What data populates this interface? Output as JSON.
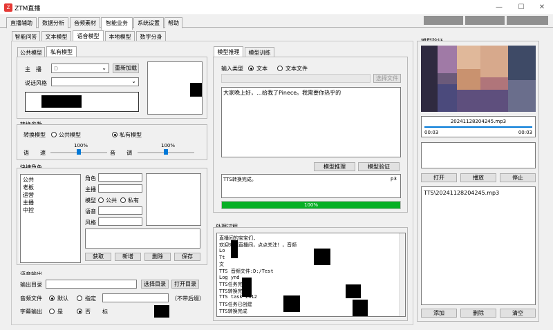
{
  "window": {
    "title": "ZTM直播",
    "icon_text": "Z",
    "min": "—",
    "max": "☐",
    "close": "✕"
  },
  "main_tabs": [
    "直播辅助",
    "数据分析",
    "音频素材",
    "智能业务",
    "系统设置",
    "帮助"
  ],
  "sub_tabs": [
    "智能问答",
    "文本模型",
    "语音模型",
    "本地模型",
    "数字分身"
  ],
  "voice": {
    "model_tabs": [
      "公共模型",
      "私有模型"
    ],
    "anchor_label": "主　播",
    "anchor_value": "D",
    "reload": "重新加载",
    "style_label": "说话风格"
  },
  "convert": {
    "title": "转换参数",
    "model_label": "转换模型",
    "public": "公共模型",
    "private": "私有模型",
    "speed_label": "语　　速",
    "speed_value": "100%",
    "pitch_label": "音　　调",
    "pitch_value": "100%"
  },
  "roles": {
    "title": "快捷角色",
    "list": [
      "公共",
      "老板",
      "运营",
      "主播",
      "中控"
    ],
    "role": "角色",
    "anchor": "主播",
    "model": "模型",
    "public": "公共",
    "private": "私有",
    "voice": "语音",
    "style": "风格",
    "get": "获取",
    "add": "新增",
    "del": "删除",
    "save": "保存"
  },
  "output": {
    "title": "语音输出",
    "dir_label": "输出目录",
    "choose_dir": "选择目录",
    "open_dir": "打开目录",
    "file_label": "音频文件",
    "default": "默认",
    "specify": "指定",
    "suffix_note": "（不带后缀）",
    "sub_label": "字幕输出",
    "yes": "是",
    "no": "否",
    "mark": "标"
  },
  "infer": {
    "tabs": [
      "模型推理",
      "模型训练"
    ],
    "input_type": "输入类型",
    "text": "文本",
    "text_file": "文本文件",
    "choose_file": "选择文件",
    "content": "大家晚上好，…给我了Pinece。我需要你热乎的",
    "infer_btn": "模型推理",
    "verify_btn": "模型验证",
    "result": "TTS转换完成。",
    "result_tail": "p3",
    "progress": "100%",
    "progress_value": 1.0
  },
  "process": {
    "title": "处理过程",
    "lines": [
      "直播间的宝宝们,",
      "欢迎来到直播间，点点关注！，音频",
      "Lo",
      "Tt",
      "文",
      "TTS    音频文件:D:/Test",
      "Log                          ynd",
      "TTS任务完成",
      "TTS转换完成",
      "TTS task 2412",
      "TTS任务已创建",
      "TTS转换完成"
    ]
  },
  "verify": {
    "title": "模型验证",
    "filename": "20241128204245.mp3",
    "time_start": "00:03",
    "time_end": "00:03",
    "progress_value": 1.0,
    "open": "打开",
    "play": "播放",
    "stop": "停止",
    "files": [
      "TTS\\20241128204245.mp3"
    ],
    "add": "添加",
    "del": "删除",
    "clear": "清空"
  },
  "colors": {
    "accent": "#0078d7",
    "progress": "#06b025",
    "app_icon": "#e53935"
  }
}
